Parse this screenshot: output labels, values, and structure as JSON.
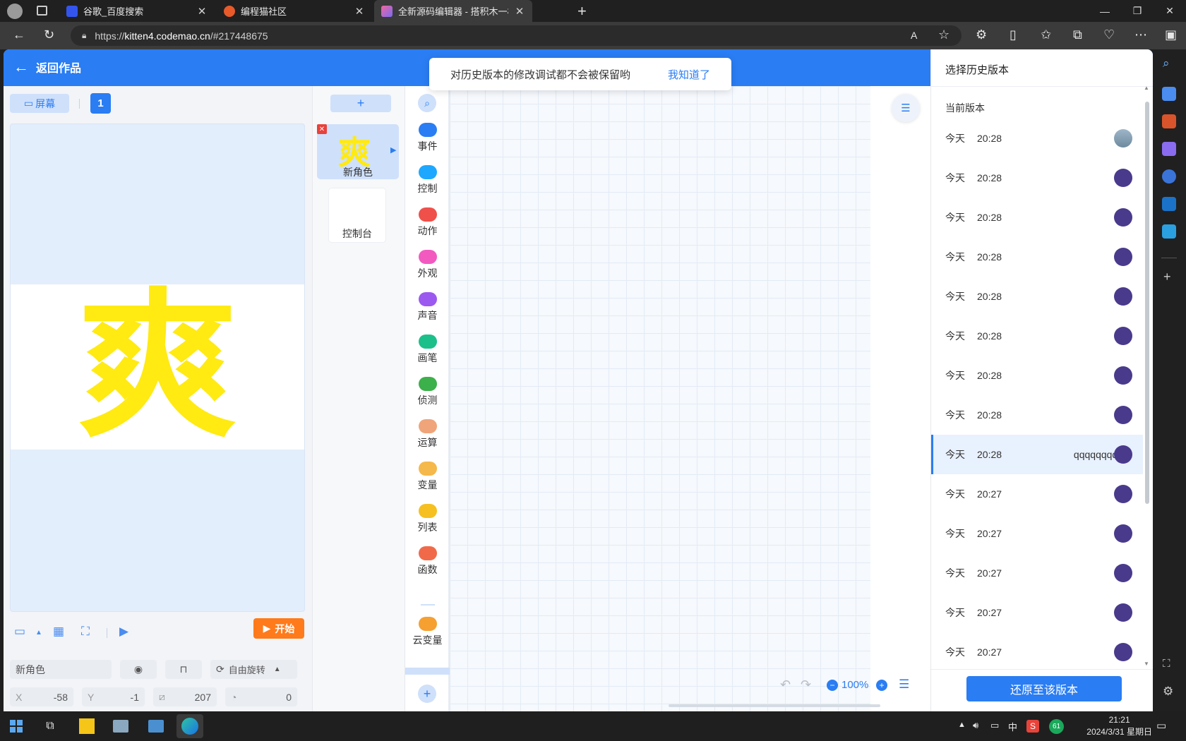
{
  "browser": {
    "tabs": [
      {
        "label": "谷歌_百度搜索",
        "color": "#3355ee"
      },
      {
        "label": "编程猫社区",
        "color": "#e85a2a"
      },
      {
        "label": "全新源码编辑器 - 搭积木一样有趣",
        "color": "#f066a0"
      }
    ],
    "url_scheme": "https://",
    "url_host": "kitten4.codemao.cn",
    "url_path": "/#217448675"
  },
  "app": {
    "back_label": "返回作品",
    "stage": {
      "screen_label": "屏幕",
      "screen_count": "1",
      "glyph": "爽",
      "start_label": "开始"
    },
    "props": {
      "name": "新角色",
      "rotate_label": "自由旋转",
      "x_label": "X",
      "x": "-58",
      "y_label": "Y",
      "y": "-1",
      "size": "207",
      "direction": "0"
    },
    "sprites": {
      "add": "+",
      "items": [
        {
          "name": "新角色",
          "glyph": "爽"
        },
        {
          "name": "控制台"
        }
      ]
    },
    "categories": [
      {
        "label": "事件",
        "color": "#2a7df3"
      },
      {
        "label": "控制",
        "color": "#1ea7ff"
      },
      {
        "label": "动作",
        "color": "#f0504a"
      },
      {
        "label": "外观",
        "color": "#f25ac0"
      },
      {
        "label": "声音",
        "color": "#9b59f0"
      },
      {
        "label": "画笔",
        "color": "#1bbf8a"
      },
      {
        "label": "侦测",
        "color": "#3cb04a"
      },
      {
        "label": "运算",
        "color": "#f0a47a"
      },
      {
        "label": "变量",
        "color": "#f5b84a"
      },
      {
        "label": "列表",
        "color": "#f5c020"
      },
      {
        "label": "函数",
        "color": "#f06a4a"
      },
      {
        "label": "云变量",
        "color": "#f5a030"
      }
    ],
    "toast": {
      "message": "对历史版本的修改调试都不会被保留哟",
      "ack": "我知道了"
    },
    "zoom": "100%",
    "history": {
      "title": "选择历史版本",
      "current_label": "当前版本",
      "versions": [
        {
          "day": "今天",
          "time": "20:28",
          "note": ""
        },
        {
          "day": "今天",
          "time": "20:28",
          "note": ""
        },
        {
          "day": "今天",
          "time": "20:28",
          "note": ""
        },
        {
          "day": "今天",
          "time": "20:28",
          "note": ""
        },
        {
          "day": "今天",
          "time": "20:28",
          "note": ""
        },
        {
          "day": "今天",
          "time": "20:28",
          "note": ""
        },
        {
          "day": "今天",
          "time": "20:28",
          "note": ""
        },
        {
          "day": "今天",
          "time": "20:28",
          "note": ""
        },
        {
          "day": "今天",
          "time": "20:28",
          "note": "qqqqqqqqq…"
        },
        {
          "day": "今天",
          "time": "20:27",
          "note": ""
        },
        {
          "day": "今天",
          "time": "20:27",
          "note": ""
        },
        {
          "day": "今天",
          "time": "20:27",
          "note": ""
        },
        {
          "day": "今天",
          "time": "20:27",
          "note": ""
        },
        {
          "day": "今天",
          "time": "20:27",
          "note": ""
        }
      ],
      "restore_label": "还原至该版本"
    }
  },
  "taskbar": {
    "ime": "中",
    "badge": "61",
    "time": "21:21",
    "date": "2024/3/31 星期日"
  },
  "colors": {
    "primary": "#2a7df3",
    "start": "#ff7a1a",
    "glyph": "#ffea12"
  }
}
